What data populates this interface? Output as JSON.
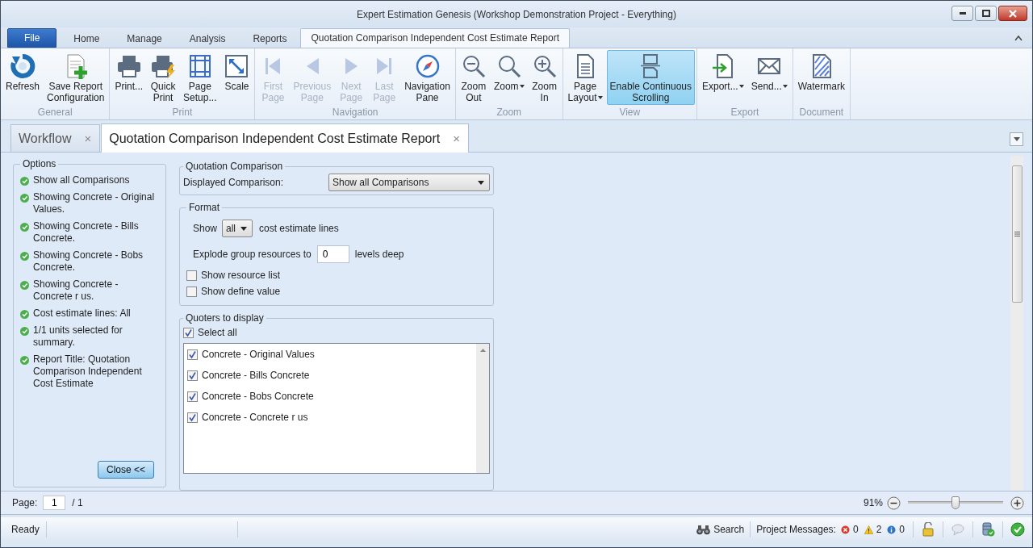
{
  "window": {
    "title": "Expert Estimation Genesis (Workshop Demonstration Project - Everything)"
  },
  "ribbon_tabs": [
    {
      "label": "File",
      "kind": "file",
      "selected": false
    },
    {
      "label": "Home",
      "kind": "tab",
      "selected": false
    },
    {
      "label": "Manage",
      "kind": "tab",
      "selected": false
    },
    {
      "label": "Analysis",
      "kind": "tab",
      "selected": false
    },
    {
      "label": "Reports",
      "kind": "tab",
      "selected": false
    },
    {
      "label": "Quotation Comparison Independent Cost Estimate Report",
      "kind": "tab",
      "selected": true
    }
  ],
  "ribbon_groups": [
    {
      "label": "General",
      "buttons": [
        {
          "label": "Refresh",
          "disabled": false,
          "dropdown": false,
          "on": false
        },
        {
          "label": "Save Report\nConfiguration",
          "disabled": false,
          "dropdown": false,
          "on": false
        }
      ]
    },
    {
      "label": "Print",
      "buttons": [
        {
          "label": "Print...",
          "disabled": false,
          "dropdown": false,
          "on": false
        },
        {
          "label": "Quick\nPrint",
          "disabled": false,
          "dropdown": false,
          "on": false
        },
        {
          "label": "Page\nSetup...",
          "disabled": false,
          "dropdown": false,
          "on": false
        },
        {
          "label": "Scale",
          "disabled": false,
          "dropdown": false,
          "on": false
        }
      ]
    },
    {
      "label": "Navigation",
      "buttons": [
        {
          "label": "First\nPage",
          "disabled": true,
          "dropdown": false,
          "on": false
        },
        {
          "label": "Previous\nPage",
          "disabled": true,
          "dropdown": false,
          "on": false
        },
        {
          "label": "Next\nPage",
          "disabled": true,
          "dropdown": false,
          "on": false
        },
        {
          "label": "Last\nPage",
          "disabled": true,
          "dropdown": false,
          "on": false
        },
        {
          "label": "Navigation\nPane",
          "disabled": false,
          "dropdown": false,
          "on": false
        }
      ]
    },
    {
      "label": "Zoom",
      "buttons": [
        {
          "label": "Zoom\nOut",
          "disabled": false,
          "dropdown": false,
          "on": false
        },
        {
          "label": "Zoom",
          "disabled": false,
          "dropdown": true,
          "on": false
        },
        {
          "label": "Zoom\nIn",
          "disabled": false,
          "dropdown": false,
          "on": false
        }
      ]
    },
    {
      "label": "View",
      "buttons": [
        {
          "label": "Page\nLayout",
          "disabled": false,
          "dropdown": true,
          "on": false
        },
        {
          "label": "Enable Continuous\nScrolling",
          "disabled": false,
          "dropdown": false,
          "on": true
        }
      ]
    },
    {
      "label": "Export",
      "buttons": [
        {
          "label": "Export...",
          "disabled": false,
          "dropdown": true,
          "on": false
        },
        {
          "label": "Send...",
          "disabled": false,
          "dropdown": true,
          "on": false
        }
      ]
    },
    {
      "label": "Document",
      "buttons": [
        {
          "label": "Watermark",
          "disabled": false,
          "dropdown": false,
          "on": false
        }
      ]
    }
  ],
  "document_tabs": [
    {
      "label": "Workflow",
      "close": "×",
      "selected": false
    },
    {
      "label": "Quotation Comparison Independent Cost Estimate Report",
      "close": "×",
      "selected": true
    }
  ],
  "options": {
    "title": "Options",
    "items": [
      "Show all Comparisons",
      "Showing Concrete - Original Values.",
      "Showing Concrete - Bills Concrete.",
      "Showing Concrete - Bobs Concrete.",
      "Showing Concrete - Concrete r us.",
      "Cost estimate lines: All",
      "1/1 units selected for summary.",
      "Report Title: Quotation Comparison Independent Cost Estimate"
    ],
    "close_button": "Close <<"
  },
  "quotation_comparison": {
    "title": "Quotation Comparison",
    "label": "Displayed Comparison:",
    "value": "Show all Comparisons"
  },
  "format": {
    "title": "Format",
    "show_label": "Show",
    "show_value": "all",
    "show_suffix": "cost estimate lines",
    "explode_label": "Explode group resources to",
    "explode_value": "0",
    "explode_suffix": "levels deep",
    "checkboxes": [
      {
        "label": "Show resource list",
        "checked": false
      },
      {
        "label": "Show define value",
        "checked": false
      }
    ]
  },
  "quoters": {
    "title": "Quoters to display",
    "select_all": {
      "label": "Select all",
      "checked": true
    },
    "items": [
      {
        "label": "Concrete - Original Values",
        "checked": true
      },
      {
        "label": "Concrete - Bills Concrete",
        "checked": true
      },
      {
        "label": "Concrete - Bobs Concrete",
        "checked": true
      },
      {
        "label": "Concrete - Concrete r us",
        "checked": true
      }
    ]
  },
  "page_bar": {
    "label": "Page:",
    "page": "1",
    "total": "/ 1",
    "zoom": "91%",
    "zoom_slider": {
      "level": 0.5
    }
  },
  "status_bar": {
    "status": "Ready",
    "search": "Search",
    "messages_label": "Project Messages:",
    "messages": [
      {
        "kind": "error",
        "count": "0"
      },
      {
        "kind": "warning",
        "count": "2"
      },
      {
        "kind": "info",
        "count": "0"
      }
    ]
  }
}
